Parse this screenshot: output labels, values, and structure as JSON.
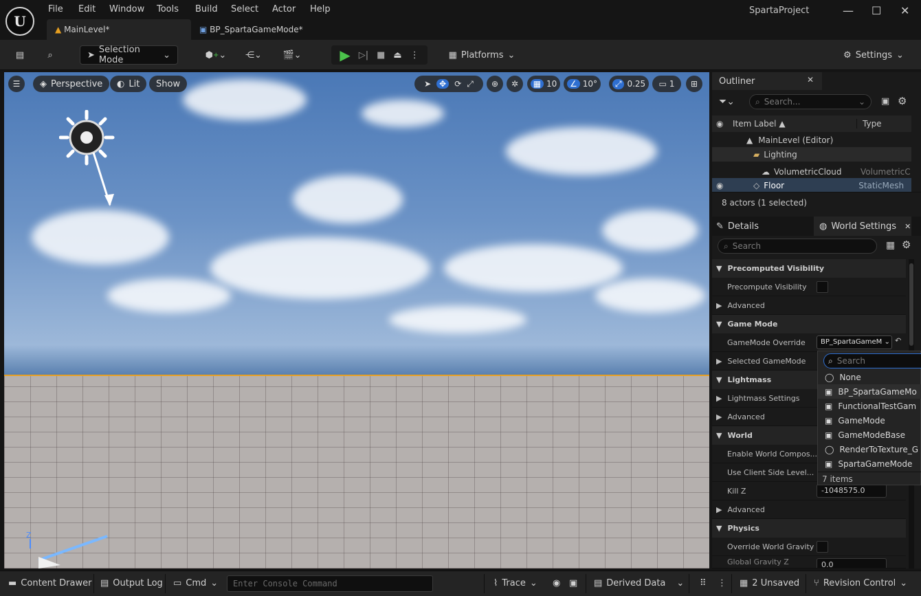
{
  "app": {
    "project_name": "SpartaProject",
    "logo_glyph": "U"
  },
  "menu": [
    "File",
    "Edit",
    "Window",
    "Tools",
    "Build",
    "Select",
    "Actor",
    "Help"
  ],
  "tabs": [
    {
      "label": "MainLevel*",
      "active": true
    },
    {
      "label": "BP_SpartaGameMode*",
      "active": false
    }
  ],
  "toolbar": {
    "selection_mode": "Selection Mode",
    "platforms": "Platforms",
    "settings": "Settings"
  },
  "viewport": {
    "perspective": "Perspective",
    "lit": "Lit",
    "show": "Show",
    "grid_snap": "10",
    "rotation_snap": "10°",
    "scale_snap": "0.25",
    "camera_speed": "1",
    "axis_z": "Z"
  },
  "outliner": {
    "title": "Outliner",
    "search_placeholder": "Search...",
    "col_label": "Item Label ▲",
    "col_type": "Type",
    "rows": [
      {
        "label": "MainLevel (Editor)",
        "type": "",
        "indent": 1
      },
      {
        "label": "Lighting",
        "type": "",
        "indent": 2
      },
      {
        "label": "VolumetricCloud",
        "type": "VolumetricC",
        "indent": 3
      },
      {
        "label": "Floor",
        "type": "StaticMesh",
        "indent": 2,
        "selected": true
      }
    ],
    "footer": "8 actors (1 selected)"
  },
  "details": {
    "tab_details": "Details",
    "tab_world_settings": "World Settings",
    "search_placeholder": "Search",
    "precomputed_visibility": "Precomputed Visibility",
    "precompute_visibility": "Precompute Visibility",
    "advanced1": "Advanced",
    "game_mode": "Game Mode",
    "gamemode_override": "GameMode Override",
    "gamemode_value": "BP_SpartaGameM",
    "selected_gamemode": "Selected GameMode",
    "lightmass": "Lightmass",
    "lightmass_settings": "Lightmass Settings",
    "advanced2": "Advanced",
    "world": "World",
    "enable_world_comp": "Enable World Compos...",
    "use_client_side": "Use Client Side Level...",
    "kill_z": "Kill Z",
    "kill_z_value": "-1048575.0",
    "advanced3": "Advanced",
    "physics": "Physics",
    "override_world_gravity": "Override World Gravity",
    "global_gravity_z": "Global Gravity Z",
    "global_gravity_value": "0.0"
  },
  "dropdown": {
    "search_placeholder": "Search",
    "items": [
      {
        "label": "None",
        "icon": "none-circle-icon"
      },
      {
        "label": "BP_SpartaGameMo",
        "icon": "blueprint-icon"
      },
      {
        "label": "FunctionalTestGam",
        "icon": "blueprint-icon"
      },
      {
        "label": "GameMode",
        "icon": "blueprint-icon"
      },
      {
        "label": "GameModeBase",
        "icon": "blueprint-icon"
      },
      {
        "label": "RenderToTexture_G",
        "icon": "none-circle-icon"
      },
      {
        "label": "SpartaGameMode",
        "icon": "blueprint-icon"
      }
    ],
    "count": "7 items"
  },
  "statusbar": {
    "content_drawer": "Content Drawer",
    "output_log": "Output Log",
    "cmd": "Cmd",
    "console_placeholder": "Enter Console Command",
    "trace": "Trace",
    "derived_data": "Derived Data",
    "unsaved": "2 Unsaved",
    "revision_control": "Revision Control"
  },
  "colors": {
    "accent": "#2f6fd1",
    "selection": "#e8a020",
    "play": "#4bc24b"
  }
}
